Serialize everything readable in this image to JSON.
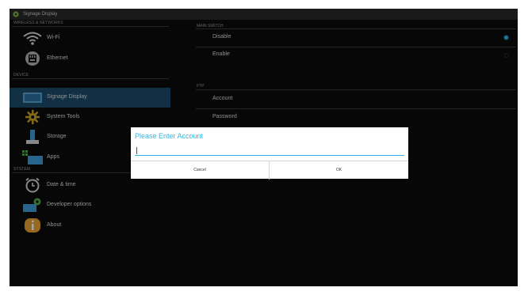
{
  "titlebar": {
    "title": "Signage Display",
    "icon": "gear-icon"
  },
  "left": {
    "headers": {
      "wireless": "WIRELESS & NETWORKS",
      "device": "DEVICE",
      "system": "SYSTEM"
    },
    "items": [
      {
        "label": "Wi-Fi",
        "icon": "wifi-icon"
      },
      {
        "label": "Ethernet",
        "icon": "ethernet-icon"
      },
      {
        "label": "Signage Display",
        "icon": "display-icon",
        "selected": true
      },
      {
        "label": "System Tools",
        "icon": "tools-gear-icon"
      },
      {
        "label": "Storage",
        "icon": "storage-icon"
      },
      {
        "label": "Apps",
        "icon": "apps-icon"
      },
      {
        "label": "Date & time",
        "icon": "clock-icon"
      },
      {
        "label": "Developer options",
        "icon": "developer-icon"
      },
      {
        "label": "About",
        "icon": "info-icon"
      }
    ]
  },
  "right": {
    "main_switch": {
      "header": "MAIN SWITCH",
      "options": [
        {
          "label": "Disable",
          "selected": true
        },
        {
          "label": "Enable",
          "selected": false
        }
      ]
    },
    "ftp": {
      "header": "FTP",
      "items": [
        "Account",
        "Password"
      ]
    }
  },
  "dialog": {
    "title": "Please Enter Account",
    "input_value": "",
    "cancel_label": "Cancel",
    "ok_label": "OK"
  },
  "colors": {
    "accent": "#33b5e5",
    "selected_row": "#1d4a69",
    "background": "#0b0b0b"
  }
}
